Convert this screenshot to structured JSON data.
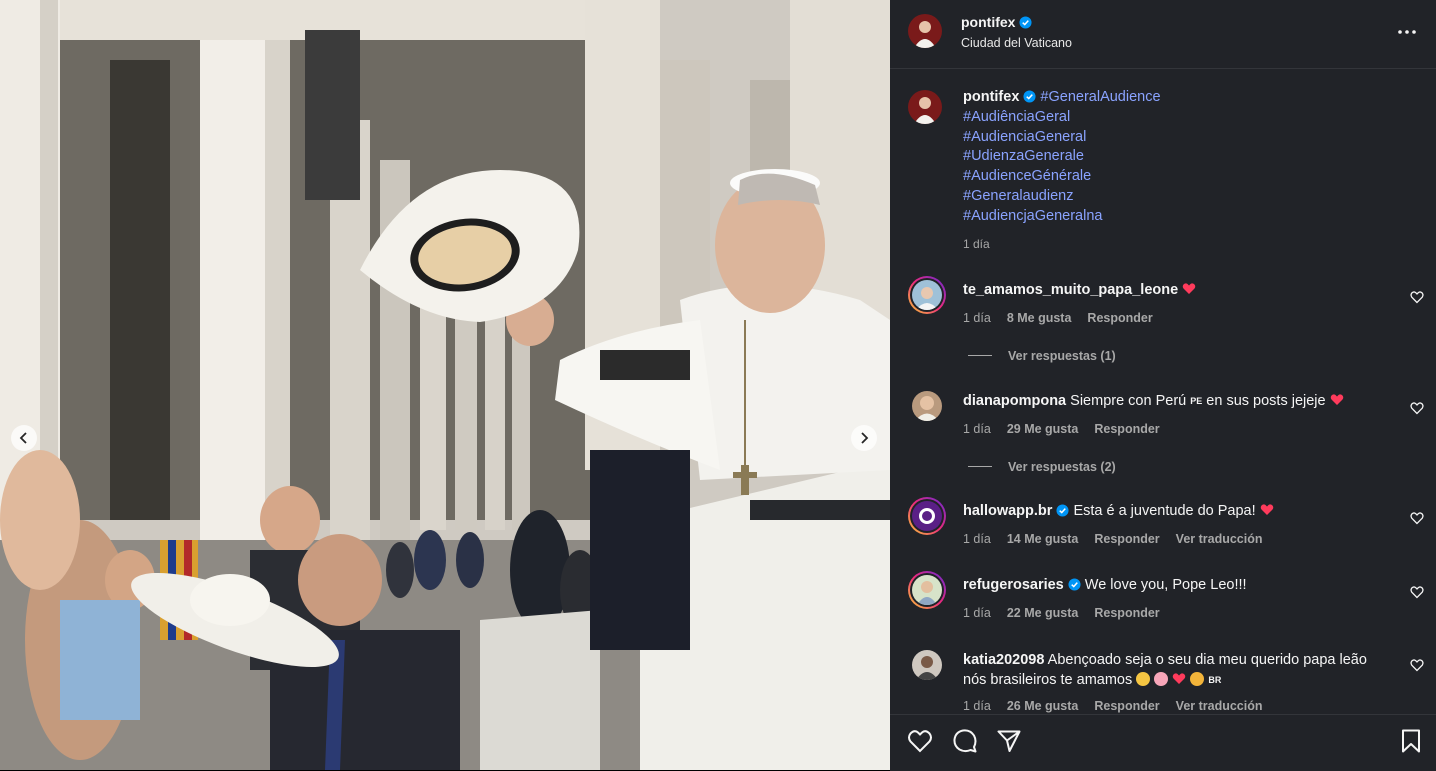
{
  "post": {
    "username": "pontifex",
    "location": "Ciudad del Vaticano"
  },
  "caption": {
    "username": "pontifex",
    "hashtags": [
      "#GeneralAudience",
      "#AudiênciaGeral",
      "#AudienciaGeneral",
      "#UdienzaGenerale",
      "#AudienceGénérale",
      "#Generalaudienz",
      "#AudiencjaGeneralna"
    ],
    "time": "1 día"
  },
  "comments": [
    {
      "username": "te_amamos_muito_papa_leone",
      "text": "",
      "time": "1 día",
      "likes": "8 Me gusta",
      "reply": "Responder",
      "replies": "Ver respuestas (1)"
    },
    {
      "username": "dianapompona",
      "text": "Siempre con Perú",
      "flag": "PE",
      "text2": "en sus posts jejeje",
      "time": "1 día",
      "likes": "29 Me gusta",
      "reply": "Responder",
      "replies": "Ver respuestas (2)"
    },
    {
      "username": "hallowapp.br",
      "text": "Esta é a juventude do Papa!",
      "time": "1 día",
      "likes": "14 Me gusta",
      "reply": "Responder",
      "translate": "Ver traducción"
    },
    {
      "username": "refugerosaries",
      "text": "We love you, Pope Leo!!!",
      "time": "1 día",
      "likes": "22 Me gusta",
      "reply": "Responder"
    },
    {
      "username": "katia202098",
      "text": "Abençoado seja o seu dia meu querido papa leão nós brasileiros te amamos",
      "flag": "BR",
      "time": "1 día",
      "likes": "26 Me gusta",
      "reply": "Responder",
      "translate": "Ver traducción"
    }
  ],
  "icons": {
    "like": "heart-icon",
    "comment": "comment-icon",
    "share": "share-icon",
    "save": "bookmark-icon",
    "more": "more-options-icon",
    "prev": "chevron-left-icon",
    "next": "chevron-right-icon"
  },
  "colors": {
    "panel_bg": "#212328",
    "hashtag": "#8aa3ff",
    "verified": "#0095f6",
    "heart": "#ff3b5c"
  }
}
